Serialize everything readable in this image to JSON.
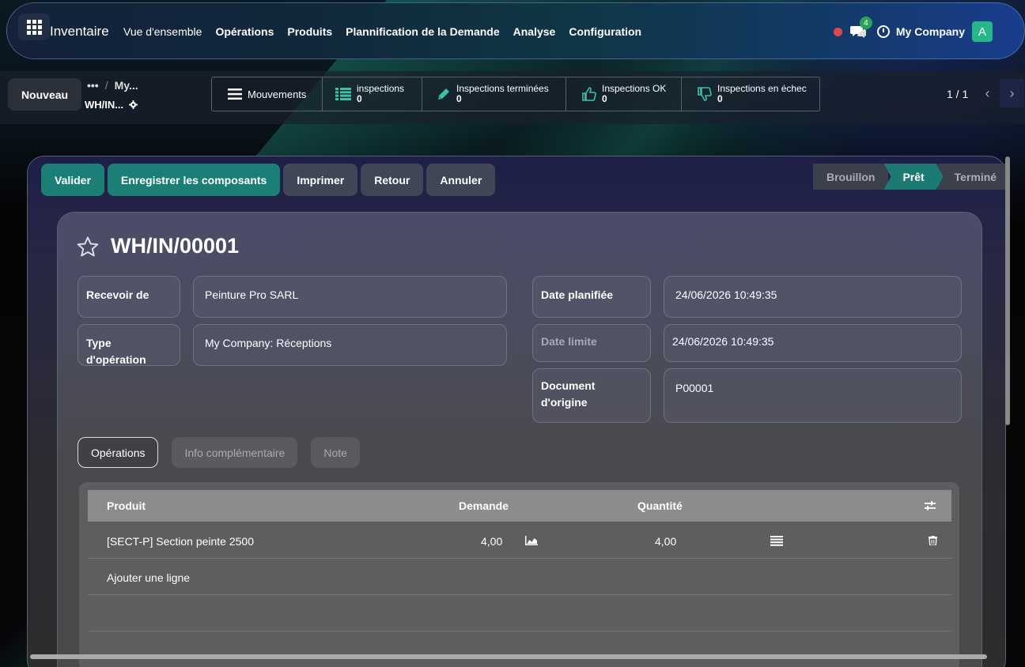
{
  "app": {
    "name": "Inventaire",
    "menu": [
      "Vue d'ensemble",
      "Opérations",
      "Produits",
      "Plannification de la Demande",
      "Analyse",
      "Configuration"
    ],
    "messages_count": "4",
    "company": "My Company",
    "avatar_letter": "A"
  },
  "control": {
    "new_label": "Nouveau",
    "breadcrumb_parent_icon": "•••",
    "breadcrumb_sep": "/",
    "breadcrumb_parent": "My...",
    "breadcrumb_current": "WH/IN...",
    "stat_buttons": [
      {
        "icon": "bars-icon",
        "label": "Mouvements",
        "value": ""
      },
      {
        "icon": "list-icon",
        "label": "inspections",
        "value": "0"
      },
      {
        "icon": "pencil-icon",
        "label": "Inspections terminées",
        "value": "0"
      },
      {
        "icon": "thumbs-up-icon",
        "label": "Inspections OK",
        "value": "0"
      },
      {
        "icon": "thumbs-down-icon",
        "label": "Inspections en échec",
        "value": "0"
      }
    ],
    "pager": "1 / 1"
  },
  "actions": {
    "validate": "Valider",
    "register": "Enregistrer les composants",
    "print": "Imprimer",
    "return": "Retour",
    "cancel": "Annuler"
  },
  "stages": [
    "Brouillon",
    "Prêt",
    "Terminé"
  ],
  "active_stage": "Prêt",
  "record": {
    "name": "WH/IN/00001",
    "fields": {
      "receive_from_label": "Recevoir de",
      "receive_from": "Peinture Pro SARL",
      "op_type_label": "Type d'opération",
      "op_type": "My Company: Réceptions",
      "scheduled_label": "Date planifiée",
      "scheduled": "24/06/2026 10:49:35",
      "deadline_label": "Date limite",
      "deadline": "24/06/2026 10:49:35",
      "origin_label": "Document d'origine",
      "origin": "P00001"
    }
  },
  "tabs": [
    "Opérations",
    "Info complémentaire",
    "Note"
  ],
  "table": {
    "headers": {
      "product": "Produit",
      "demand": "Demande",
      "quantity": "Quantité"
    },
    "rows": [
      {
        "product": "[SECT-P] Section peinte 2500",
        "demand": "4,00",
        "quantity": "4,00"
      }
    ],
    "add_line": "Ajouter une ligne"
  },
  "colors": {
    "primary": "#1b7f75",
    "secondary": "#3f4656",
    "avatar": "#27b58a"
  }
}
